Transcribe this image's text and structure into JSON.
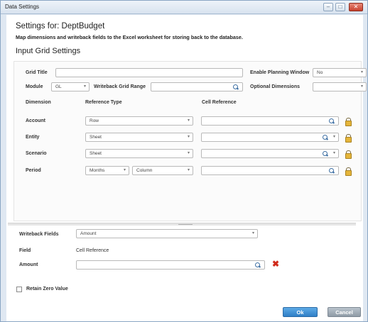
{
  "window": {
    "title": "Data Settings",
    "buttons": [
      "–",
      "□",
      "✕"
    ]
  },
  "header": {
    "settings_for": "Settings for: DeptBudget",
    "description": "Map dimensions and writeback fields to the Excel worksheet for storing back to the database.",
    "section_title": "Input Grid Settings"
  },
  "grid": {
    "grid_title_label": "Grid Title",
    "grid_title_value": "",
    "enable_planning_label": "Enable Planning Window",
    "enable_planning_value": "No",
    "module_label": "Module",
    "module_value": "GL",
    "writeback_range_label": "Writeback Grid Range",
    "writeback_range_value": "",
    "optional_dimensions_label": "Optional Dimensions",
    "optional_dimensions_value": ""
  },
  "dimensions": {
    "col_dimension": "Dimension",
    "col_reference_type": "Reference Type",
    "col_cell_reference": "Cell Reference",
    "rows": [
      {
        "name": "Account",
        "reference_type": "Row",
        "cell_reference": ""
      },
      {
        "name": "Entity",
        "reference_type": "Sheet",
        "cell_reference": ""
      },
      {
        "name": "Scenario",
        "reference_type": "Sheet",
        "cell_reference": ""
      },
      {
        "name": "Period",
        "reference_type": "Months",
        "reference_type_2": "Column",
        "cell_reference": ""
      }
    ]
  },
  "writeback": {
    "fields_label": "Writeback Fields",
    "fields_value": "Amount",
    "col_field": "Field",
    "col_cell_reference": "Cell Reference",
    "rows": [
      {
        "field": "Amount",
        "cell_reference": ""
      }
    ]
  },
  "options": {
    "retain_zero_label": "Retain Zero Value",
    "retain_zero_checked": false
  },
  "footer": {
    "ok_label": "Ok",
    "cancel_label": "Cancel"
  },
  "colors": {
    "accent": "#2f7fc6",
    "delete": "#d0291a",
    "lock": "#e5b53a"
  },
  "icons": [
    "magnifier-icon",
    "lock-icon",
    "delete-x-icon",
    "chevron-down-icon",
    "checkbox-icon"
  ]
}
